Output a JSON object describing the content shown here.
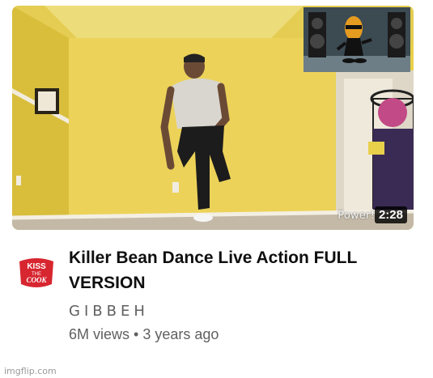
{
  "video": {
    "duration": "2:28",
    "watermark": "Power!",
    "title_line1": "Killer Bean Dance Live Action FULL",
    "title_line2": "VERSION",
    "channel": "GIBBEH",
    "views": "6M views",
    "separator": "•",
    "age": "3 years ago"
  },
  "avatar": {
    "text_top": "KISS",
    "text_mid": "THE",
    "text_bottom": "COOK"
  },
  "footer": {
    "site": "imgflip.com"
  },
  "colors": {
    "wall": "#e8d04a",
    "title": "#0f0f0f",
    "meta": "#606060",
    "badge": "#d72630"
  }
}
